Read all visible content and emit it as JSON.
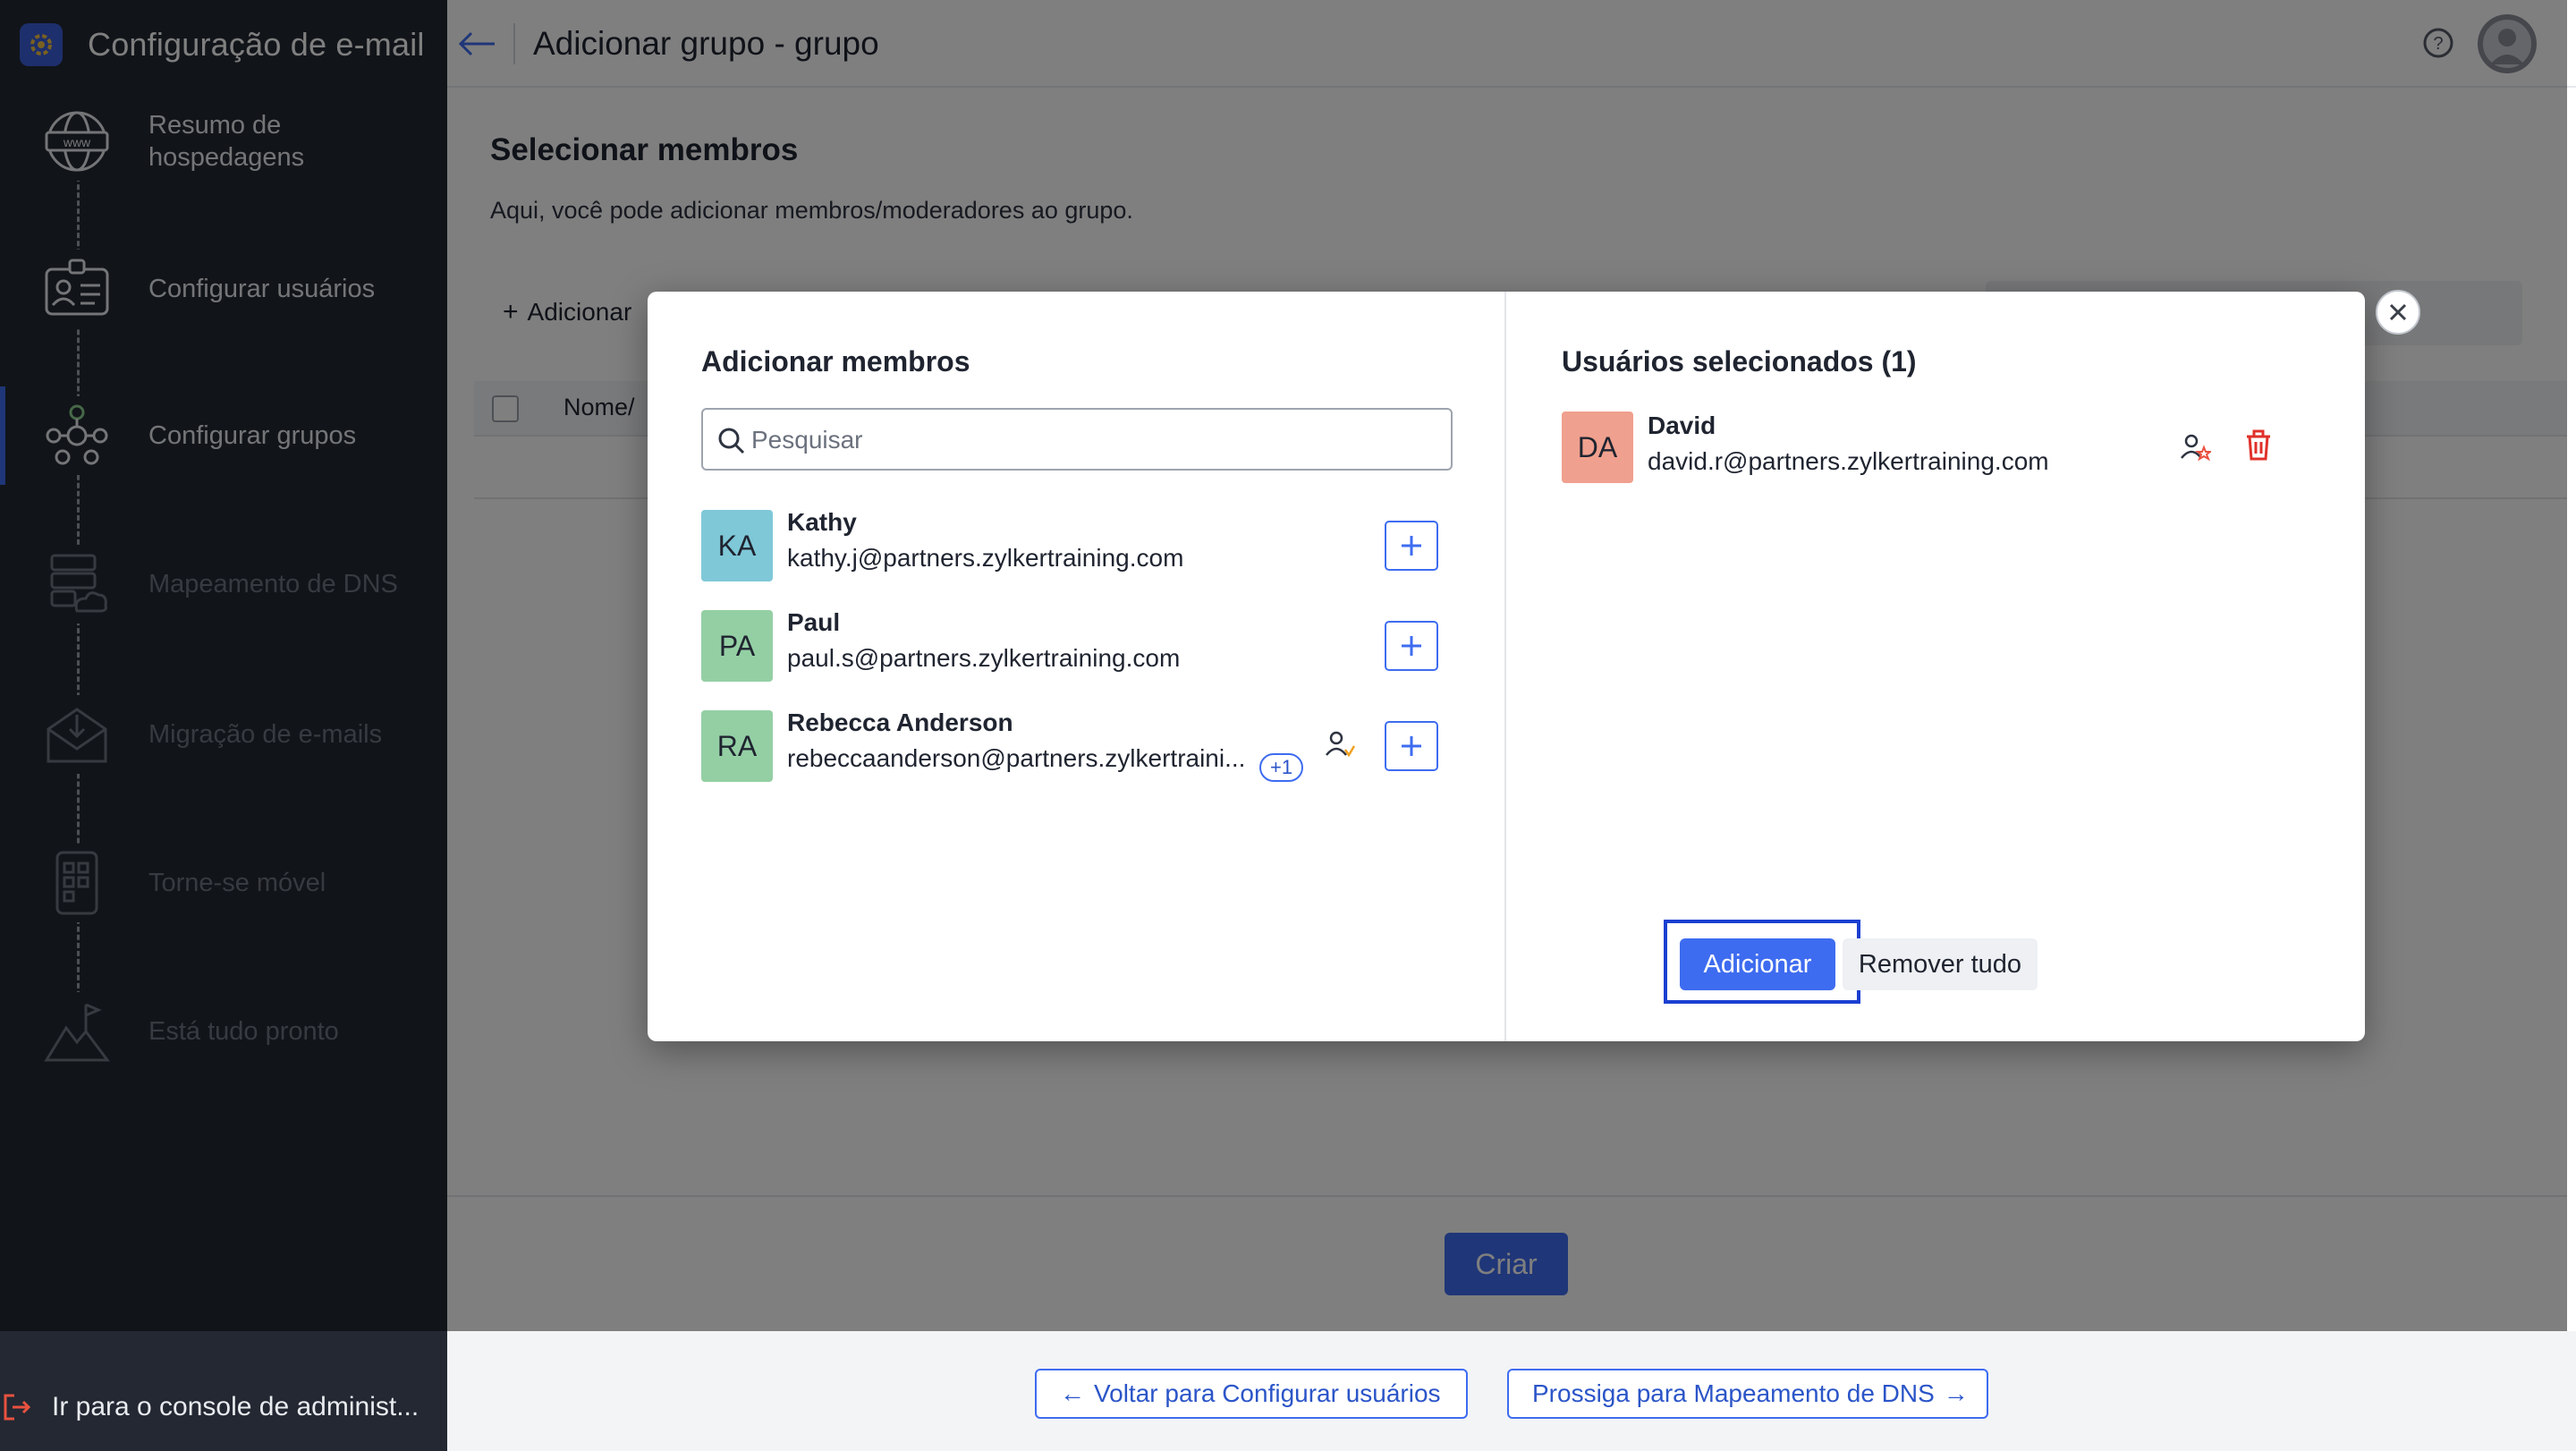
{
  "app": {
    "title": "Configuração de e-mail",
    "accent_color": "#3e6cf0"
  },
  "sidebar": {
    "steps": [
      {
        "label": "Resumo de hospedagens",
        "icon": "globe-www-icon",
        "state": "done"
      },
      {
        "label": "Configurar usuários",
        "icon": "user-card-icon",
        "state": "done"
      },
      {
        "label": "Configurar grupos",
        "icon": "group-network-icon",
        "state": "active"
      },
      {
        "label": "Mapeamento de DNS",
        "icon": "dns-server-icon",
        "state": "disabled"
      },
      {
        "label": "Migração de e-mails",
        "icon": "mail-download-icon",
        "state": "disabled"
      },
      {
        "label": "Torne-se móvel",
        "icon": "mobile-apps-icon",
        "state": "disabled"
      },
      {
        "label": "Está tudo pronto",
        "icon": "mountain-flag-icon",
        "state": "disabled"
      }
    ],
    "admin_link": "Ir para o console de administ..."
  },
  "header": {
    "title": "Adicionar grupo - grupo"
  },
  "page": {
    "section_title": "Selecionar membros",
    "section_subtitle": "Aqui, você pode adicionar membros/moderadores ao grupo.",
    "add_link": "Adicionar",
    "table_col_name": "Nome/",
    "create_button": "Criar"
  },
  "modal": {
    "left_title": "Adicionar membros",
    "search_placeholder": "Pesquisar",
    "members": [
      {
        "initials": "KA",
        "name": "Kathy",
        "email": "kathy.j@partners.zylkertraining.com",
        "avatar_color": "#7fc8d8"
      },
      {
        "initials": "PA",
        "name": "Paul",
        "email": "paul.s@partners.zylkertraining.com",
        "avatar_color": "#94cfa4"
      },
      {
        "initials": "RA",
        "name": "Rebecca Anderson",
        "email": "rebeccaanderson@partners.zylkertraini...",
        "avatar_color": "#94cfa4",
        "badge": "+1"
      }
    ],
    "right_title": "Usuários selecionados (1)",
    "selected": [
      {
        "initials": "DA",
        "name": "David",
        "email": "david.r@partners.zylkertraining.com"
      }
    ],
    "add_button": "Adicionar",
    "remove_all_button": "Remover tudo"
  },
  "bottom_nav": {
    "back": "Voltar para Configurar usuários",
    "next": "Prossiga para Mapeamento de DNS"
  }
}
